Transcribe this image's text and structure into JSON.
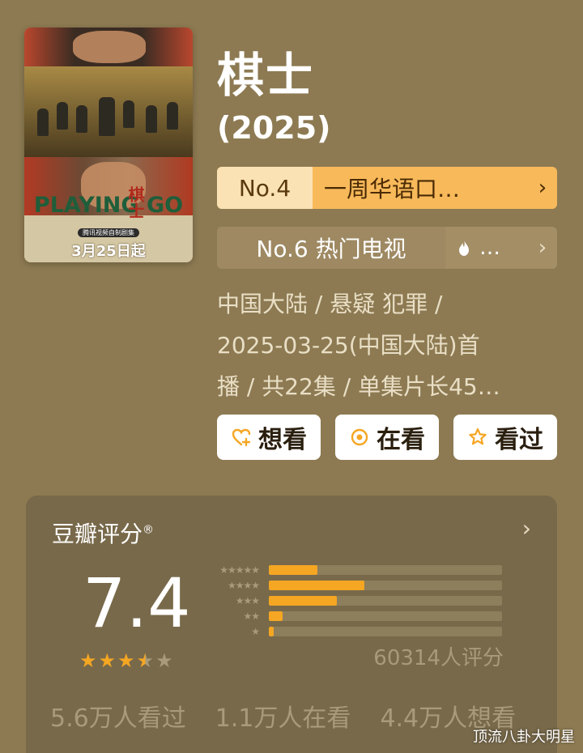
{
  "poster": {
    "title_en": "PLAYING GO",
    "title_cn": "棋士",
    "subtitle": "腾讯视频自制剧集",
    "premiere": "3月25日起"
  },
  "title": "棋士",
  "year": "(2025)",
  "rank_primary": {
    "no": "No.4",
    "text": "一周华语口…",
    "accent": "#f7b95a"
  },
  "rank_secondary": {
    "no": "No.6 热门电视",
    "text": "…",
    "icon": "fire-icon"
  },
  "meta": {
    "line1": "中国大陆 / 悬疑 犯罪 /",
    "line2": "2025-03-25(中国大陆)首",
    "line3": "播 / 共22集 / 单集片长45…"
  },
  "actions": {
    "want": "想看",
    "watching": "在看",
    "watched": "看过"
  },
  "rating": {
    "label": "豆瓣评分",
    "label_mark": "®",
    "score": "7.4",
    "stars_filled": 3.5,
    "count": "60314人评分",
    "distribution": [
      {
        "stars": "★★★★★",
        "fraction": 0.21
      },
      {
        "stars": "★★★★",
        "fraction": 0.41
      },
      {
        "stars": "★★★",
        "fraction": 0.29
      },
      {
        "stars": "★★",
        "fraction": 0.06
      },
      {
        "stars": "★",
        "fraction": 0.02
      }
    ],
    "stats": {
      "watched": "5.6万人看过",
      "watching": "1.1万人在看",
      "want": "4.4万人想看"
    }
  },
  "watermark": "顶流八卦大明星",
  "colors": {
    "star": "#f5a623",
    "bg": "#8d7a52"
  }
}
